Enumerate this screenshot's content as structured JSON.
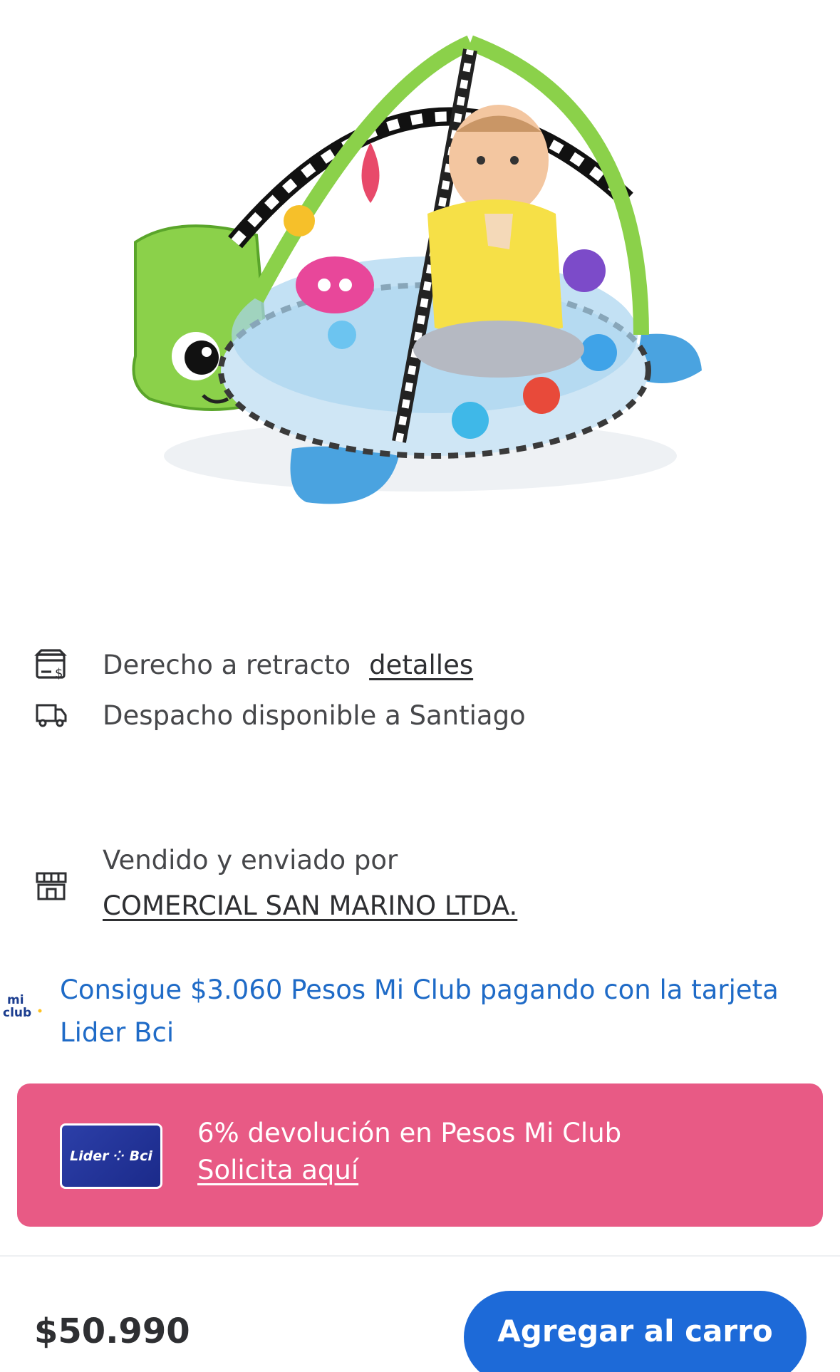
{
  "product": {
    "image_alt": "Gimnasio de juego tortuga con bebé"
  },
  "info": {
    "return_policy_label": "Derecho a retracto",
    "return_policy_link": "detalles",
    "shipping_label": "Despacho disponible a Santiago"
  },
  "seller": {
    "label": "Vendido y enviado por",
    "name": "COMERCIAL SAN MARINO LTDA."
  },
  "miclub": {
    "logo_text_top": "mi",
    "logo_text_bottom": "club",
    "message": "Consigue $3.060 Pesos Mi Club pagando con la tarjeta Lider Bci"
  },
  "promo": {
    "card_brand": "Lider ⁘ Bci",
    "title": "6% devolución en Pesos Mi Club",
    "link": "Solicita aquí",
    "background_color": "#e85a85"
  },
  "footer": {
    "price": "$50.990",
    "add_to_cart_label": "Agregar al carro",
    "button_color": "#1d6ad8"
  },
  "icons": {
    "return": "store-return-icon",
    "shipping": "truck-icon",
    "seller": "storefront-icon"
  }
}
